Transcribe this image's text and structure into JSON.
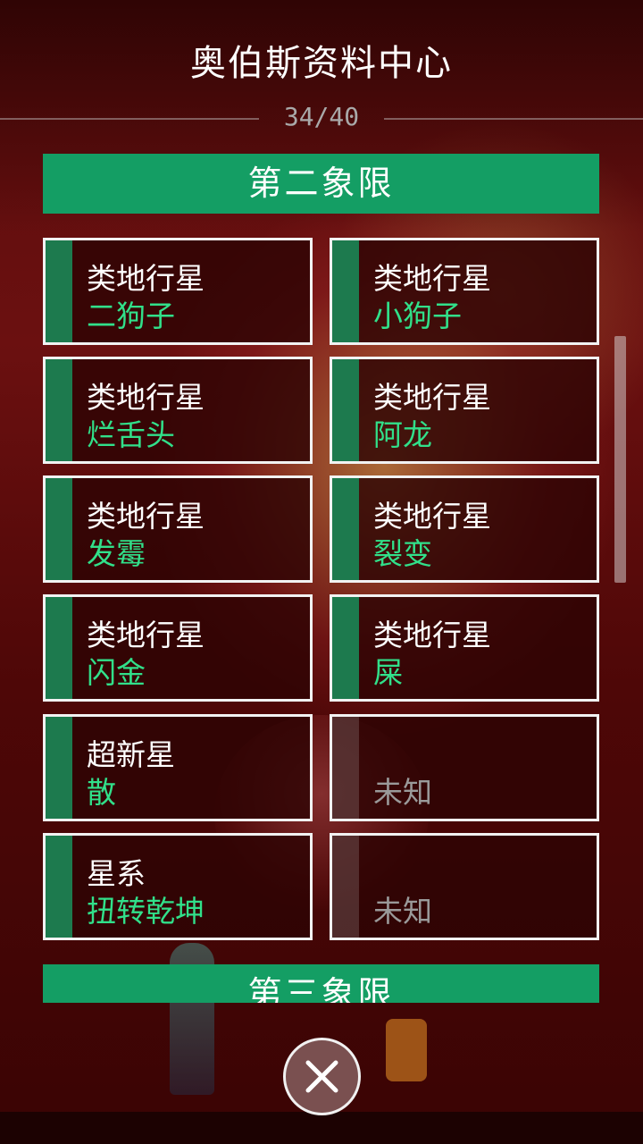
{
  "header": {
    "title": "奥伯斯资料中心",
    "progress": "34/40"
  },
  "sections": [
    {
      "title": "第二象限",
      "cards": [
        {
          "type": "类地行星",
          "name": "二狗子",
          "unlocked": true
        },
        {
          "type": "类地行星",
          "name": "小狗子",
          "unlocked": true
        },
        {
          "type": "类地行星",
          "name": "烂舌头",
          "unlocked": true
        },
        {
          "type": "类地行星",
          "name": "阿龙",
          "unlocked": true
        },
        {
          "type": "类地行星",
          "name": "发霉",
          "unlocked": true
        },
        {
          "type": "类地行星",
          "name": "裂变",
          "unlocked": true
        },
        {
          "type": "类地行星",
          "name": "闪金",
          "unlocked": true
        },
        {
          "type": "类地行星",
          "name": "屎",
          "unlocked": true
        },
        {
          "type": "超新星",
          "name": "散",
          "unlocked": true
        },
        {
          "type": "",
          "name": "未知",
          "unlocked": false
        },
        {
          "type": "星系",
          "name": "扭转乾坤",
          "unlocked": true
        },
        {
          "type": "",
          "name": "未知",
          "unlocked": false
        }
      ]
    },
    {
      "title": "第三象限"
    }
  ],
  "colors": {
    "section_header": "#149e64",
    "card_strip": "#1d7a4e",
    "name_text": "#31e08a",
    "locked_text": "#9a9a9a"
  },
  "icons": {
    "close": "close-icon"
  }
}
